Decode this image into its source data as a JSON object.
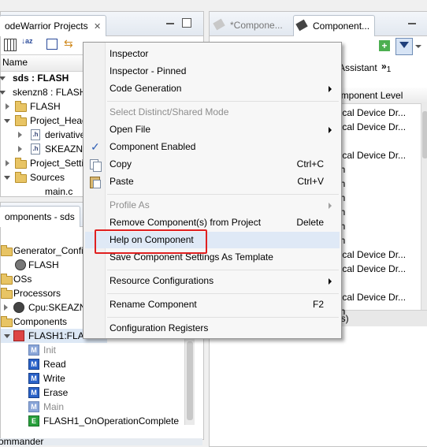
{
  "left_top_panel": {
    "tab_label": "odeWarrior Projects",
    "tab_close": "✕",
    "column_header": "Name",
    "tree": [
      {
        "label": "sds : FLASH",
        "bold": true
      },
      {
        "label": "skenzn8 : FLASH"
      },
      {
        "label": "FLASH"
      },
      {
        "label": "Project_Head"
      },
      {
        "label": "derivative"
      },
      {
        "label": "SKEAZN8"
      },
      {
        "label": "Project_Setti"
      },
      {
        "label": "Sources"
      },
      {
        "label": "main.c"
      }
    ]
  },
  "left_bottom_panel": {
    "tab_label": "omponents - sds",
    "tree": [
      {
        "label": "Generator_Confi"
      },
      {
        "label": "FLASH"
      },
      {
        "label": "OSs"
      },
      {
        "label": "Processors"
      },
      {
        "label": "Cpu:SKEAZN"
      },
      {
        "label": "Components"
      },
      {
        "label": "FLASH1:FLAS"
      },
      {
        "label": "Init",
        "disabled": true
      },
      {
        "label": "Read"
      },
      {
        "label": "Write"
      },
      {
        "label": "Erase"
      },
      {
        "label": "Main",
        "disabled": true
      },
      {
        "label": "FLASH1_OnOperationComplete"
      }
    ],
    "bottom_tab": "ommander"
  },
  "right_panel": {
    "tab1": "*Compone...",
    "tab2": "Component...",
    "subtab": "Assistant",
    "subtab_more": "»",
    "subtab_count": "1",
    "column_header": "omponent Level",
    "rows": [
      "gical Device Dr...",
      "gical Device Dr...",
      "w",
      "gical Device Dr...",
      "gh",
      "gh",
      "gh",
      "gh",
      "gh",
      "gh",
      "gical Device Dr...",
      "gical Device Dr...",
      "w",
      "gical Device Dr...",
      "gh"
    ],
    "footer": "ds)"
  },
  "context_menu": {
    "items": [
      {
        "label": "Inspector"
      },
      {
        "label": "Inspector - Pinned"
      },
      {
        "label": "Code Generation",
        "submenu": true
      },
      {
        "label": "Select Distinct/Shared Mode",
        "disabled": true
      },
      {
        "label": "Open File",
        "submenu": true
      },
      {
        "label": "Component Enabled",
        "checked": true
      },
      {
        "label": "Copy",
        "shortcut": "Ctrl+C"
      },
      {
        "label": "Paste",
        "shortcut": "Ctrl+V"
      },
      {
        "label": "Profile As",
        "disabled": true,
        "submenu": true
      },
      {
        "label": "Remove Component(s) from Project",
        "shortcut": "Delete"
      },
      {
        "label": "Help on Component",
        "highlighted": true
      },
      {
        "label": "Save Component Settings As Template"
      },
      {
        "label": "Resource Configurations",
        "submenu": true
      },
      {
        "label": "Rename Component",
        "shortcut": "F2"
      },
      {
        "label": "Configuration Registers"
      }
    ],
    "check_glyph": "✓"
  },
  "colors": {
    "highlight_box": "#e02020",
    "menu_highlight": "#dfe9f6",
    "icon_blue": "#2a62c8"
  },
  "icons": [
    "close-icon",
    "folder-icon",
    "header-file-icon",
    "method-icon",
    "chip-icon",
    "gear-icon",
    "filter-icon",
    "copy-icon",
    "paste-icon",
    "check-icon",
    "chevron-right-icon"
  ]
}
